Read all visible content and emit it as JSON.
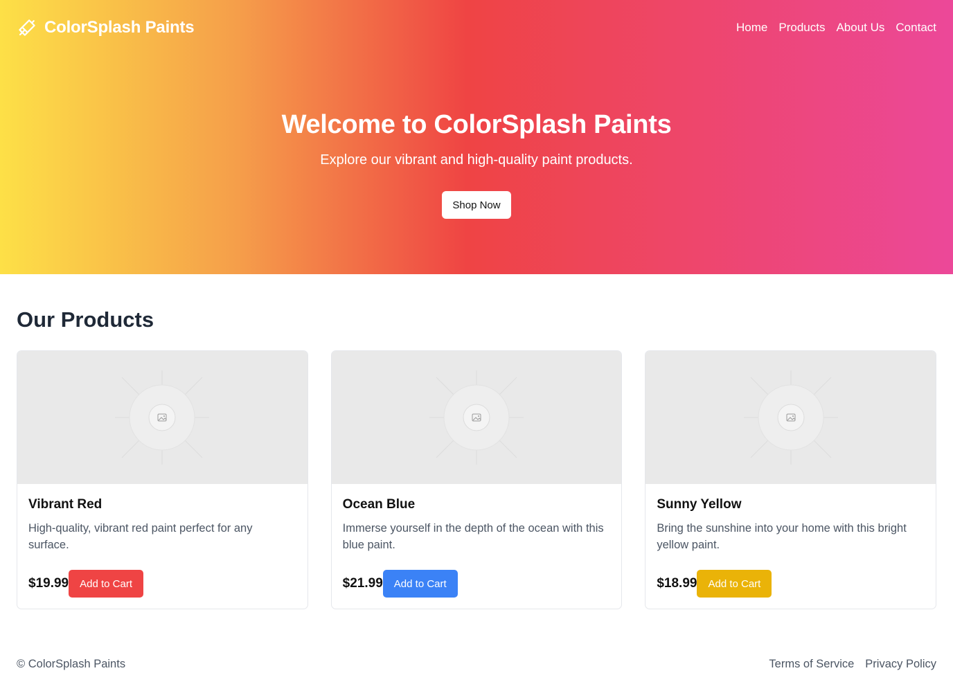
{
  "brand": {
    "name": "ColorSplash Paints",
    "logo_icon": "paintbrush-icon"
  },
  "nav": {
    "items": [
      {
        "label": "Home"
      },
      {
        "label": "Products"
      },
      {
        "label": "About Us"
      },
      {
        "label": "Contact"
      }
    ]
  },
  "hero": {
    "title": "Welcome to ColorSplash Paints",
    "subtitle": "Explore our vibrant and high-quality paint products.",
    "cta_label": "Shop Now",
    "gradient_colors": [
      "#fde047",
      "#f59e4a",
      "#ef4444",
      "#ec4899"
    ]
  },
  "products": {
    "heading": "Our Products",
    "items": [
      {
        "name": "Vibrant Red",
        "description": "High-quality, vibrant red paint perfect for any surface.",
        "price": "$19.99",
        "button_label": "Add to Cart",
        "button_color": "#ef4444",
        "image_icon": "image-placeholder-icon"
      },
      {
        "name": "Ocean Blue",
        "description": "Immerse yourself in the depth of the ocean with this blue paint.",
        "price": "$21.99",
        "button_label": "Add to Cart",
        "button_color": "#3b82f6",
        "image_icon": "image-placeholder-icon"
      },
      {
        "name": "Sunny Yellow",
        "description": "Bring the sunshine into your home with this bright yellow paint.",
        "price": "$18.99",
        "button_label": "Add to Cart",
        "button_color": "#eab308",
        "image_icon": "image-placeholder-icon"
      }
    ]
  },
  "footer": {
    "copyright": "© ColorSplash Paints",
    "links": [
      {
        "label": "Terms of Service"
      },
      {
        "label": "Privacy Policy"
      }
    ]
  }
}
